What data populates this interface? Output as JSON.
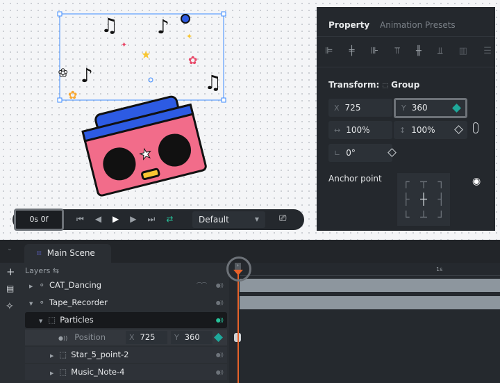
{
  "property_panel": {
    "tabs": [
      "Property",
      "Animation Presets"
    ],
    "transform_label": "Transform:",
    "transform_type": "Group",
    "x_label": "X",
    "x_value": "725",
    "y_label": "Y",
    "y_value": "360",
    "width_value": "100%",
    "height_value": "100%",
    "rotation_value": "0°",
    "anchor_label": "Anchor point",
    "keyframe_color": "#1fa89a"
  },
  "player": {
    "time": "0s 0f",
    "preset": "Default"
  },
  "timeline": {
    "scene_tab": "Main Scene",
    "layers_label": "Layers",
    "ruler_label": "1s",
    "playhead_color": "#e8622a",
    "layers": [
      {
        "name": "CAT_Dancing"
      },
      {
        "name": "Tape_Recorder"
      },
      {
        "name": "Particles"
      },
      {
        "name": "Star_5_point-2"
      },
      {
        "name": "Music_Note-4"
      }
    ],
    "position_row": {
      "label": "Position",
      "x_label": "X",
      "x": "725",
      "y_label": "Y",
      "y": "360"
    }
  }
}
